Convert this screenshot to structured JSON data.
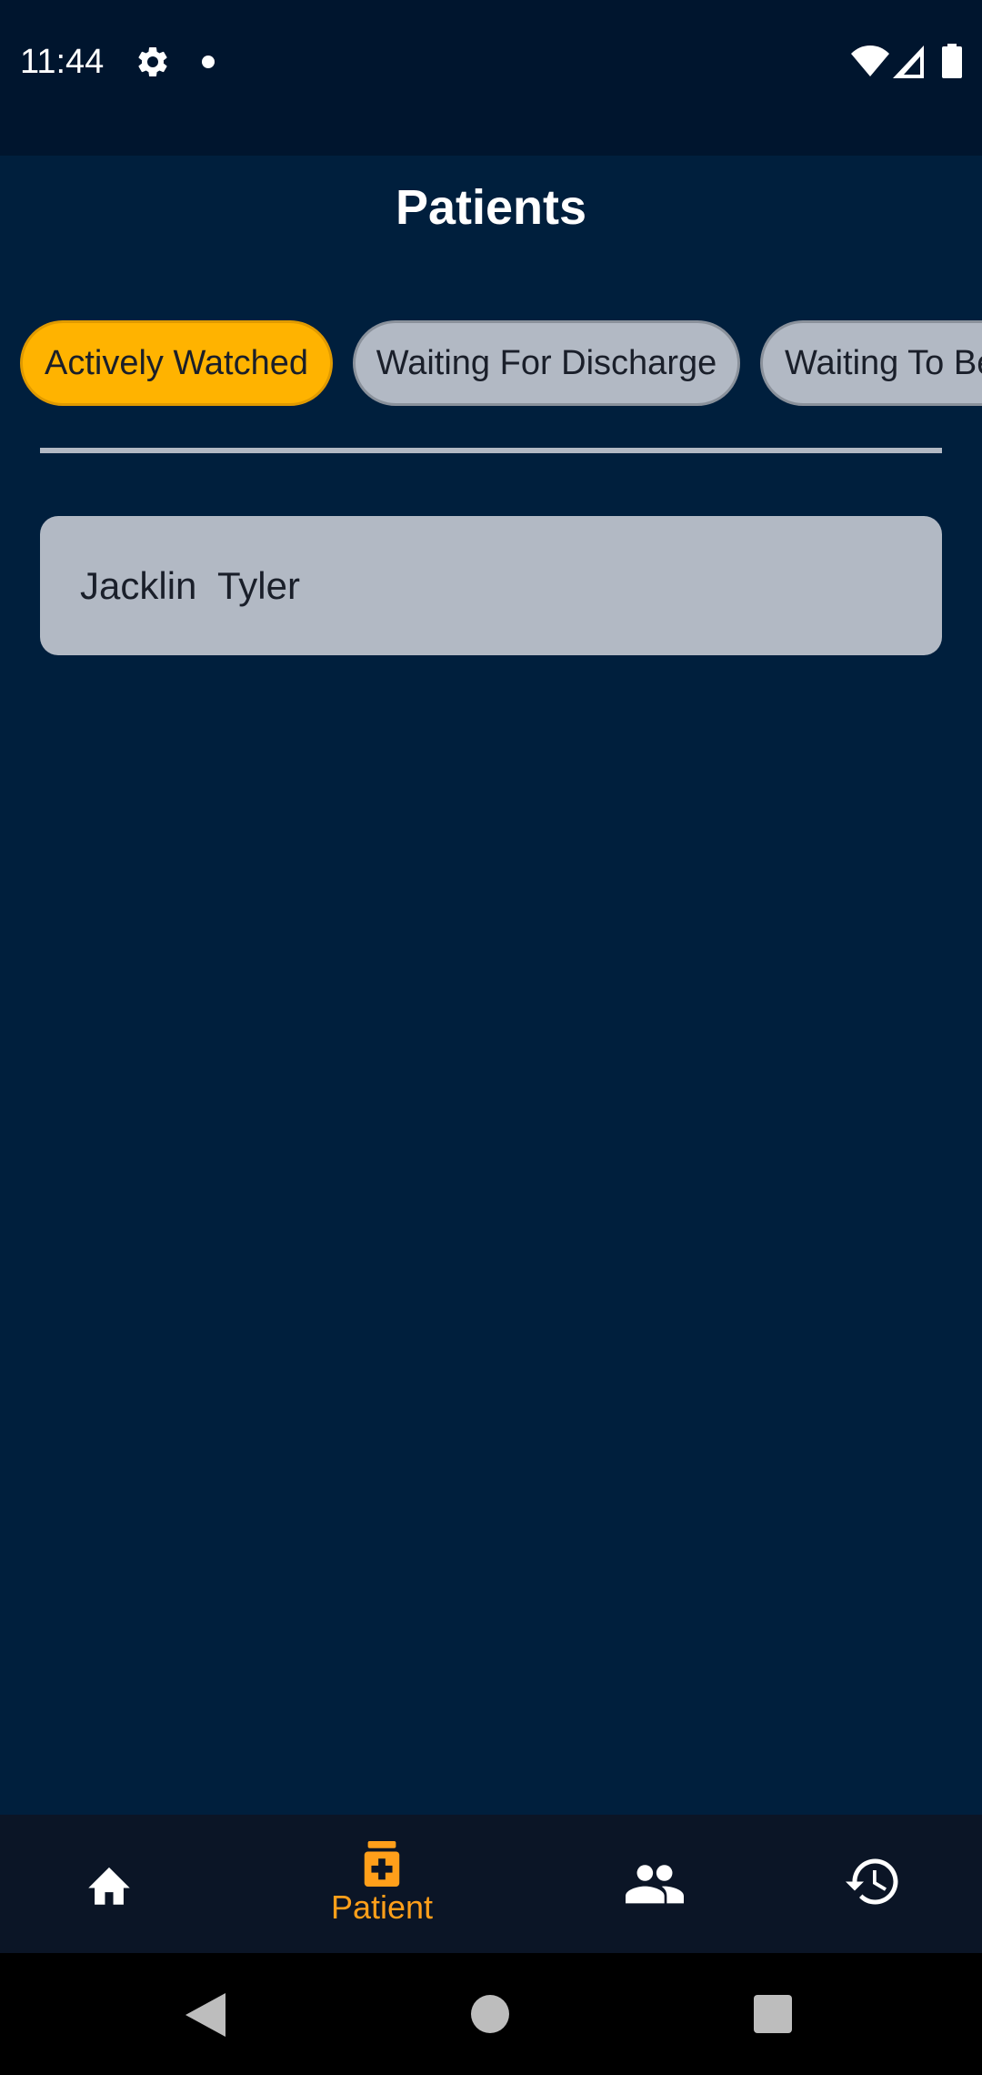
{
  "status_bar": {
    "time": "11:44",
    "icons": [
      "gear-icon",
      "notification-dot",
      "wifi-icon",
      "signal-icon",
      "battery-icon"
    ]
  },
  "header": {
    "title": "Patients"
  },
  "filters": {
    "chips": [
      {
        "label": "Actively Watched",
        "active": true
      },
      {
        "label": "Waiting For Discharge",
        "active": false
      },
      {
        "label": "Waiting To Be",
        "active": false
      }
    ]
  },
  "patients": [
    {
      "name": "Jacklin  Tyler"
    }
  ],
  "bottom_nav": {
    "items": [
      {
        "icon": "home-icon",
        "label": ""
      },
      {
        "icon": "medicine-icon",
        "label": "Patient",
        "active": true
      },
      {
        "icon": "people-icon",
        "label": ""
      },
      {
        "icon": "history-icon",
        "label": ""
      }
    ]
  },
  "colors": {
    "background": "#001f3d",
    "status_bar": "#00152e",
    "accent": "#ffb300",
    "nav_active": "#ff9f1a",
    "chip_inactive": "#b2b9c4",
    "bottom_nav": "#0b1526"
  }
}
